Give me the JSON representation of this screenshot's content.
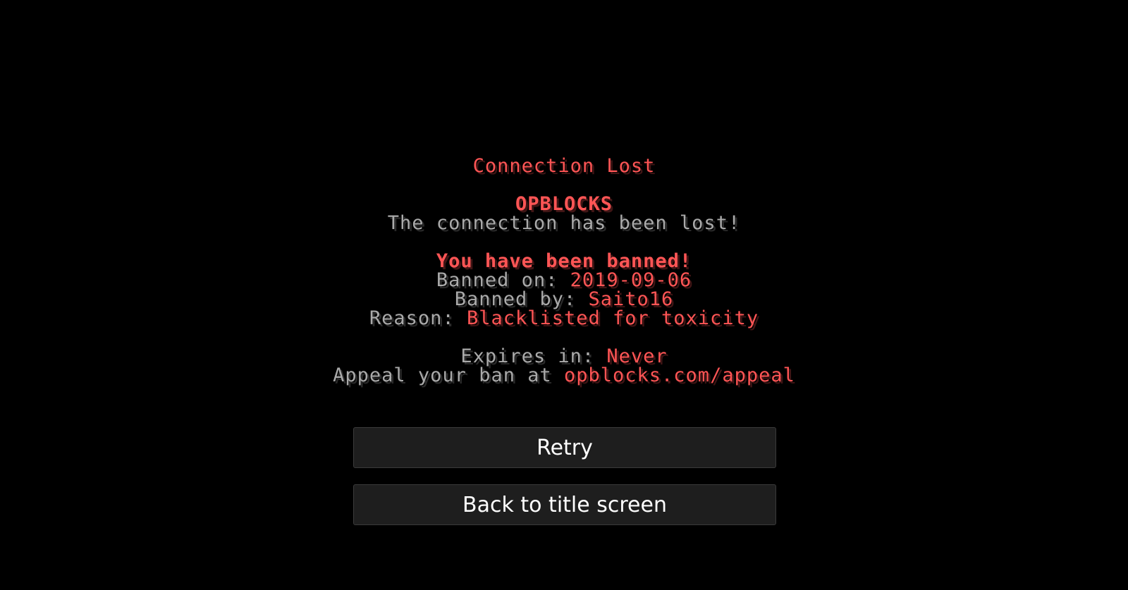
{
  "screen_title": "Connection Lost",
  "server_name": "OPBLOCKS",
  "lost_message": "The connection has been lost!",
  "ban_heading": "You have been banned!",
  "banned_on": {
    "label": "Banned on: ",
    "value": "2019-09-06"
  },
  "banned_by": {
    "label": "Banned by: ",
    "value": "Saito16"
  },
  "reason": {
    "label": "Reason: ",
    "value": "Blacklisted for toxicity"
  },
  "expires": {
    "label": "Expires in: ",
    "value": "Never"
  },
  "appeal": {
    "label": "Appeal your ban at ",
    "value": "opblocks.com/appeal"
  },
  "buttons": {
    "retry_label": "Retry",
    "back_label": "Back to title screen"
  },
  "colors": {
    "background": "#000000",
    "highlight_red": "#ff5555",
    "text_gray": "#aaaaaa",
    "button_bg": "#1e1e1e",
    "button_text": "#ffffff"
  }
}
